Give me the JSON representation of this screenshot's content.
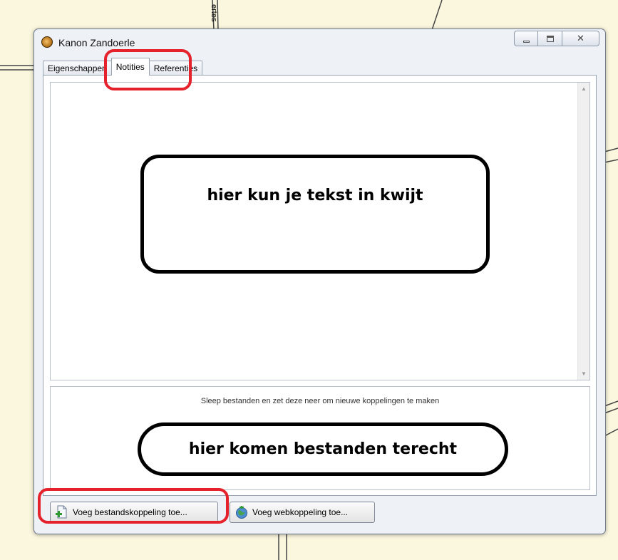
{
  "background": {
    "label": "ertes"
  },
  "window": {
    "title": "Kanon Zandoerle",
    "caption_buttons": {
      "minimize": "minimize",
      "maximize": "maximize",
      "close": "✕"
    }
  },
  "tabs": [
    {
      "label": "Eigenschappen",
      "active": false
    },
    {
      "label": "Notities",
      "active": true
    },
    {
      "label": "Referenties",
      "active": false
    }
  ],
  "notes": {
    "callout_text": "hier kun je tekst in kwijt"
  },
  "files": {
    "drop_hint": "Sleep bestanden en zet deze neer om nieuwe koppelingen te maken",
    "callout_text": "hier komen bestanden terecht"
  },
  "buttons": {
    "add_file_link": "Voeg bestandskoppeling toe...",
    "add_web_link": "Voeg webkoppeling toe..."
  },
  "colors": {
    "highlight": "#e5212b",
    "window_bg": "#eef1f6",
    "desktop_bg": "#fbf7df"
  },
  "icons": {
    "app": "cannon-icon",
    "file_link": "file-add-icon",
    "web_link": "globe-icon"
  }
}
